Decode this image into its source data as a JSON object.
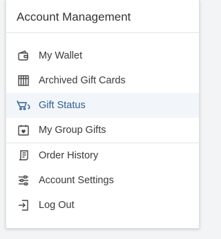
{
  "panel": {
    "title": "Account Management"
  },
  "menu": {
    "items": [
      {
        "label": "My Wallet",
        "icon": "wallet-icon"
      },
      {
        "label": "Archived Gift Cards",
        "icon": "archive-icon"
      },
      {
        "label": "Gift Status",
        "icon": "gift-status-icon",
        "active": true
      },
      {
        "label": "My Group Gifts",
        "icon": "group-gift-calendar-icon"
      },
      {
        "label": "Order History",
        "icon": "receipt-icon"
      },
      {
        "label": "Account Settings",
        "icon": "sliders-icon"
      },
      {
        "label": "Log Out",
        "icon": "logout-icon"
      }
    ]
  },
  "colors": {
    "active_text": "#2f5f8f",
    "active_bg": "#f2f5f9",
    "text": "#3a3a3a"
  }
}
